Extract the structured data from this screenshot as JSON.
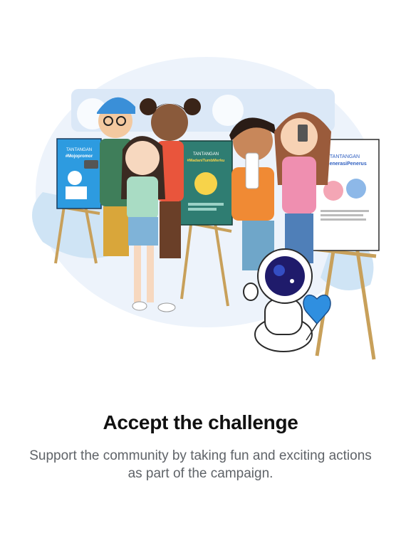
{
  "onboarding": {
    "title": "Accept the challenge",
    "subtitle": "Support the community by taking fun and exciting actions as part of the campaign."
  },
  "posters": {
    "left": {
      "heading": "TANTANGAN",
      "hashtag": "#Mojopromor"
    },
    "middle": {
      "heading": "TANTANGAN",
      "hashtag": "#MadaniTumbMerku"
    },
    "right": {
      "heading": "TANTANGAN",
      "hashtag": "#GenerasiPenerus"
    }
  },
  "colors": {
    "background": "#ffffff",
    "title": "#111111",
    "subtitle": "#5f6368",
    "blob": "#e9f1fb",
    "accent_blue": "#2f8fe0",
    "poster_teal": "#2f7d72"
  },
  "icons": [
    "astronaut-mascot-icon",
    "heart-balloon-icon",
    "easel-icon",
    "smartphone-icon"
  ]
}
